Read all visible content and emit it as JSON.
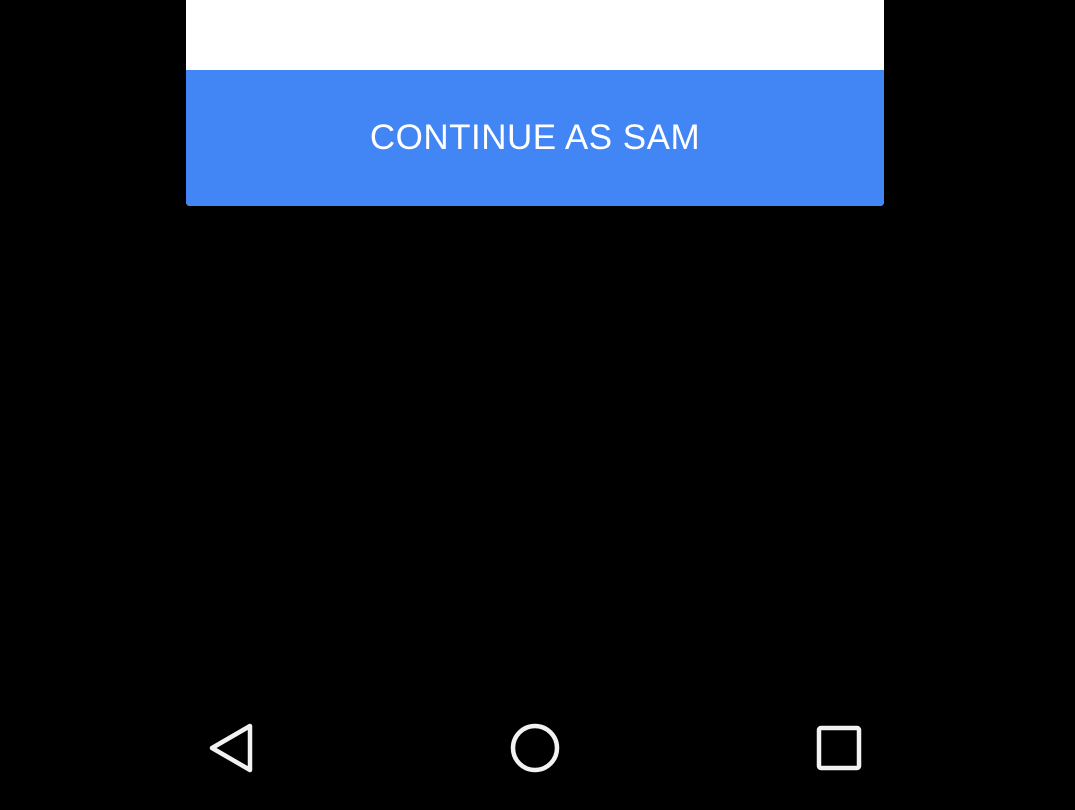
{
  "dialog": {
    "continue_label": "CONTINUE AS SAM"
  },
  "colors": {
    "accent": "#4285f4",
    "background": "#000000",
    "card": "#ffffff",
    "nav_icon": "#f2f2f2"
  },
  "nav_bar": {
    "icons": [
      "back-icon",
      "home-icon",
      "recents-icon"
    ]
  }
}
